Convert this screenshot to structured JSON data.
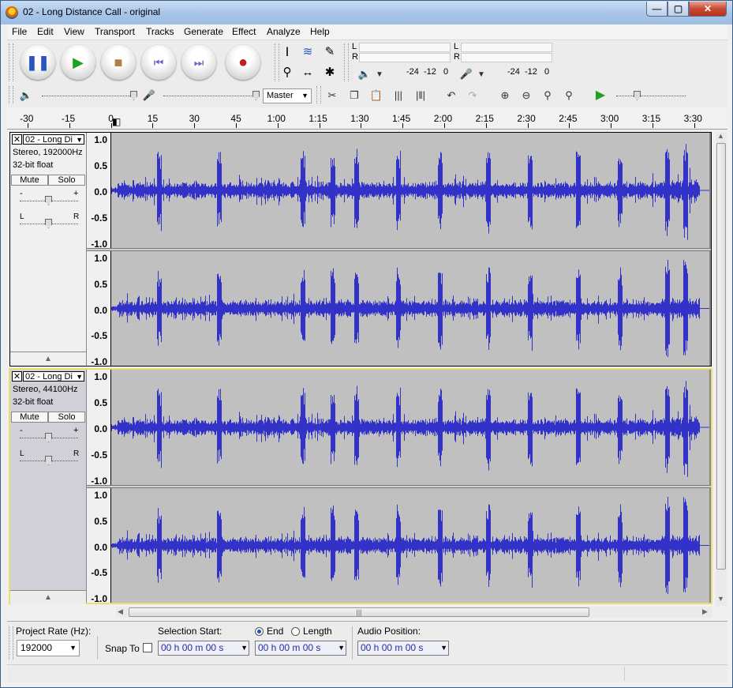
{
  "window": {
    "title": "02 - Long Distance Call - original",
    "min": "—",
    "max": "▢",
    "close": "✕"
  },
  "menu": [
    "File",
    "Edit",
    "View",
    "Transport",
    "Tracks",
    "Generate",
    "Effect",
    "Analyze",
    "Help"
  ],
  "transport": {
    "pause": "pause-icon",
    "play": "play-icon",
    "stop": "stop-icon",
    "skip_start": "skip-start-icon",
    "skip_end": "skip-end-icon",
    "record": "record-icon"
  },
  "meters": {
    "play_L": "L",
    "play_R": "R",
    "rec_L": "L",
    "rec_R": "R",
    "play_scale": [
      "-24",
      "-12",
      "0"
    ],
    "rec_scale": [
      "-24",
      "-12",
      "0"
    ]
  },
  "mixer": {
    "device": "Master"
  },
  "ruler": {
    "labels": [
      "-30",
      "-15",
      "0",
      "15",
      "30",
      "45",
      "1:00",
      "1:15",
      "1:30",
      "1:45",
      "2:00",
      "2:15",
      "2:30",
      "2:45",
      "3:00",
      "3:15",
      "3:30"
    ]
  },
  "tracks": [
    {
      "name": "02 - Long Di",
      "format": "Stereo, 192000Hz",
      "bits": "32-bit float",
      "mute": "Mute",
      "solo": "Solo",
      "gain_minus": "-",
      "gain_plus": "+",
      "pan_L": "L",
      "pan_R": "R"
    },
    {
      "name": "02 - Long Di",
      "format": "Stereo, 44100Hz",
      "bits": "32-bit float",
      "mute": "Mute",
      "solo": "Solo",
      "gain_minus": "-",
      "gain_plus": "+",
      "pan_L": "L",
      "pan_R": "R"
    }
  ],
  "vruler": [
    "1.0",
    "0.5",
    "0.0",
    "-0.5",
    "-1.0"
  ],
  "selection": {
    "project_rate_label": "Project Rate (Hz):",
    "project_rate": "192000",
    "snap_to": "Snap To",
    "selection_start_label": "Selection Start:",
    "end_label": "End",
    "length_label": "Length",
    "audio_position_label": "Audio Position:",
    "time_value": "00 h 00 m 00 s"
  },
  "colors": {
    "waveform": "#3232c8",
    "wave_bg": "#c0c0c0",
    "selected_border": "#e8e06c"
  }
}
